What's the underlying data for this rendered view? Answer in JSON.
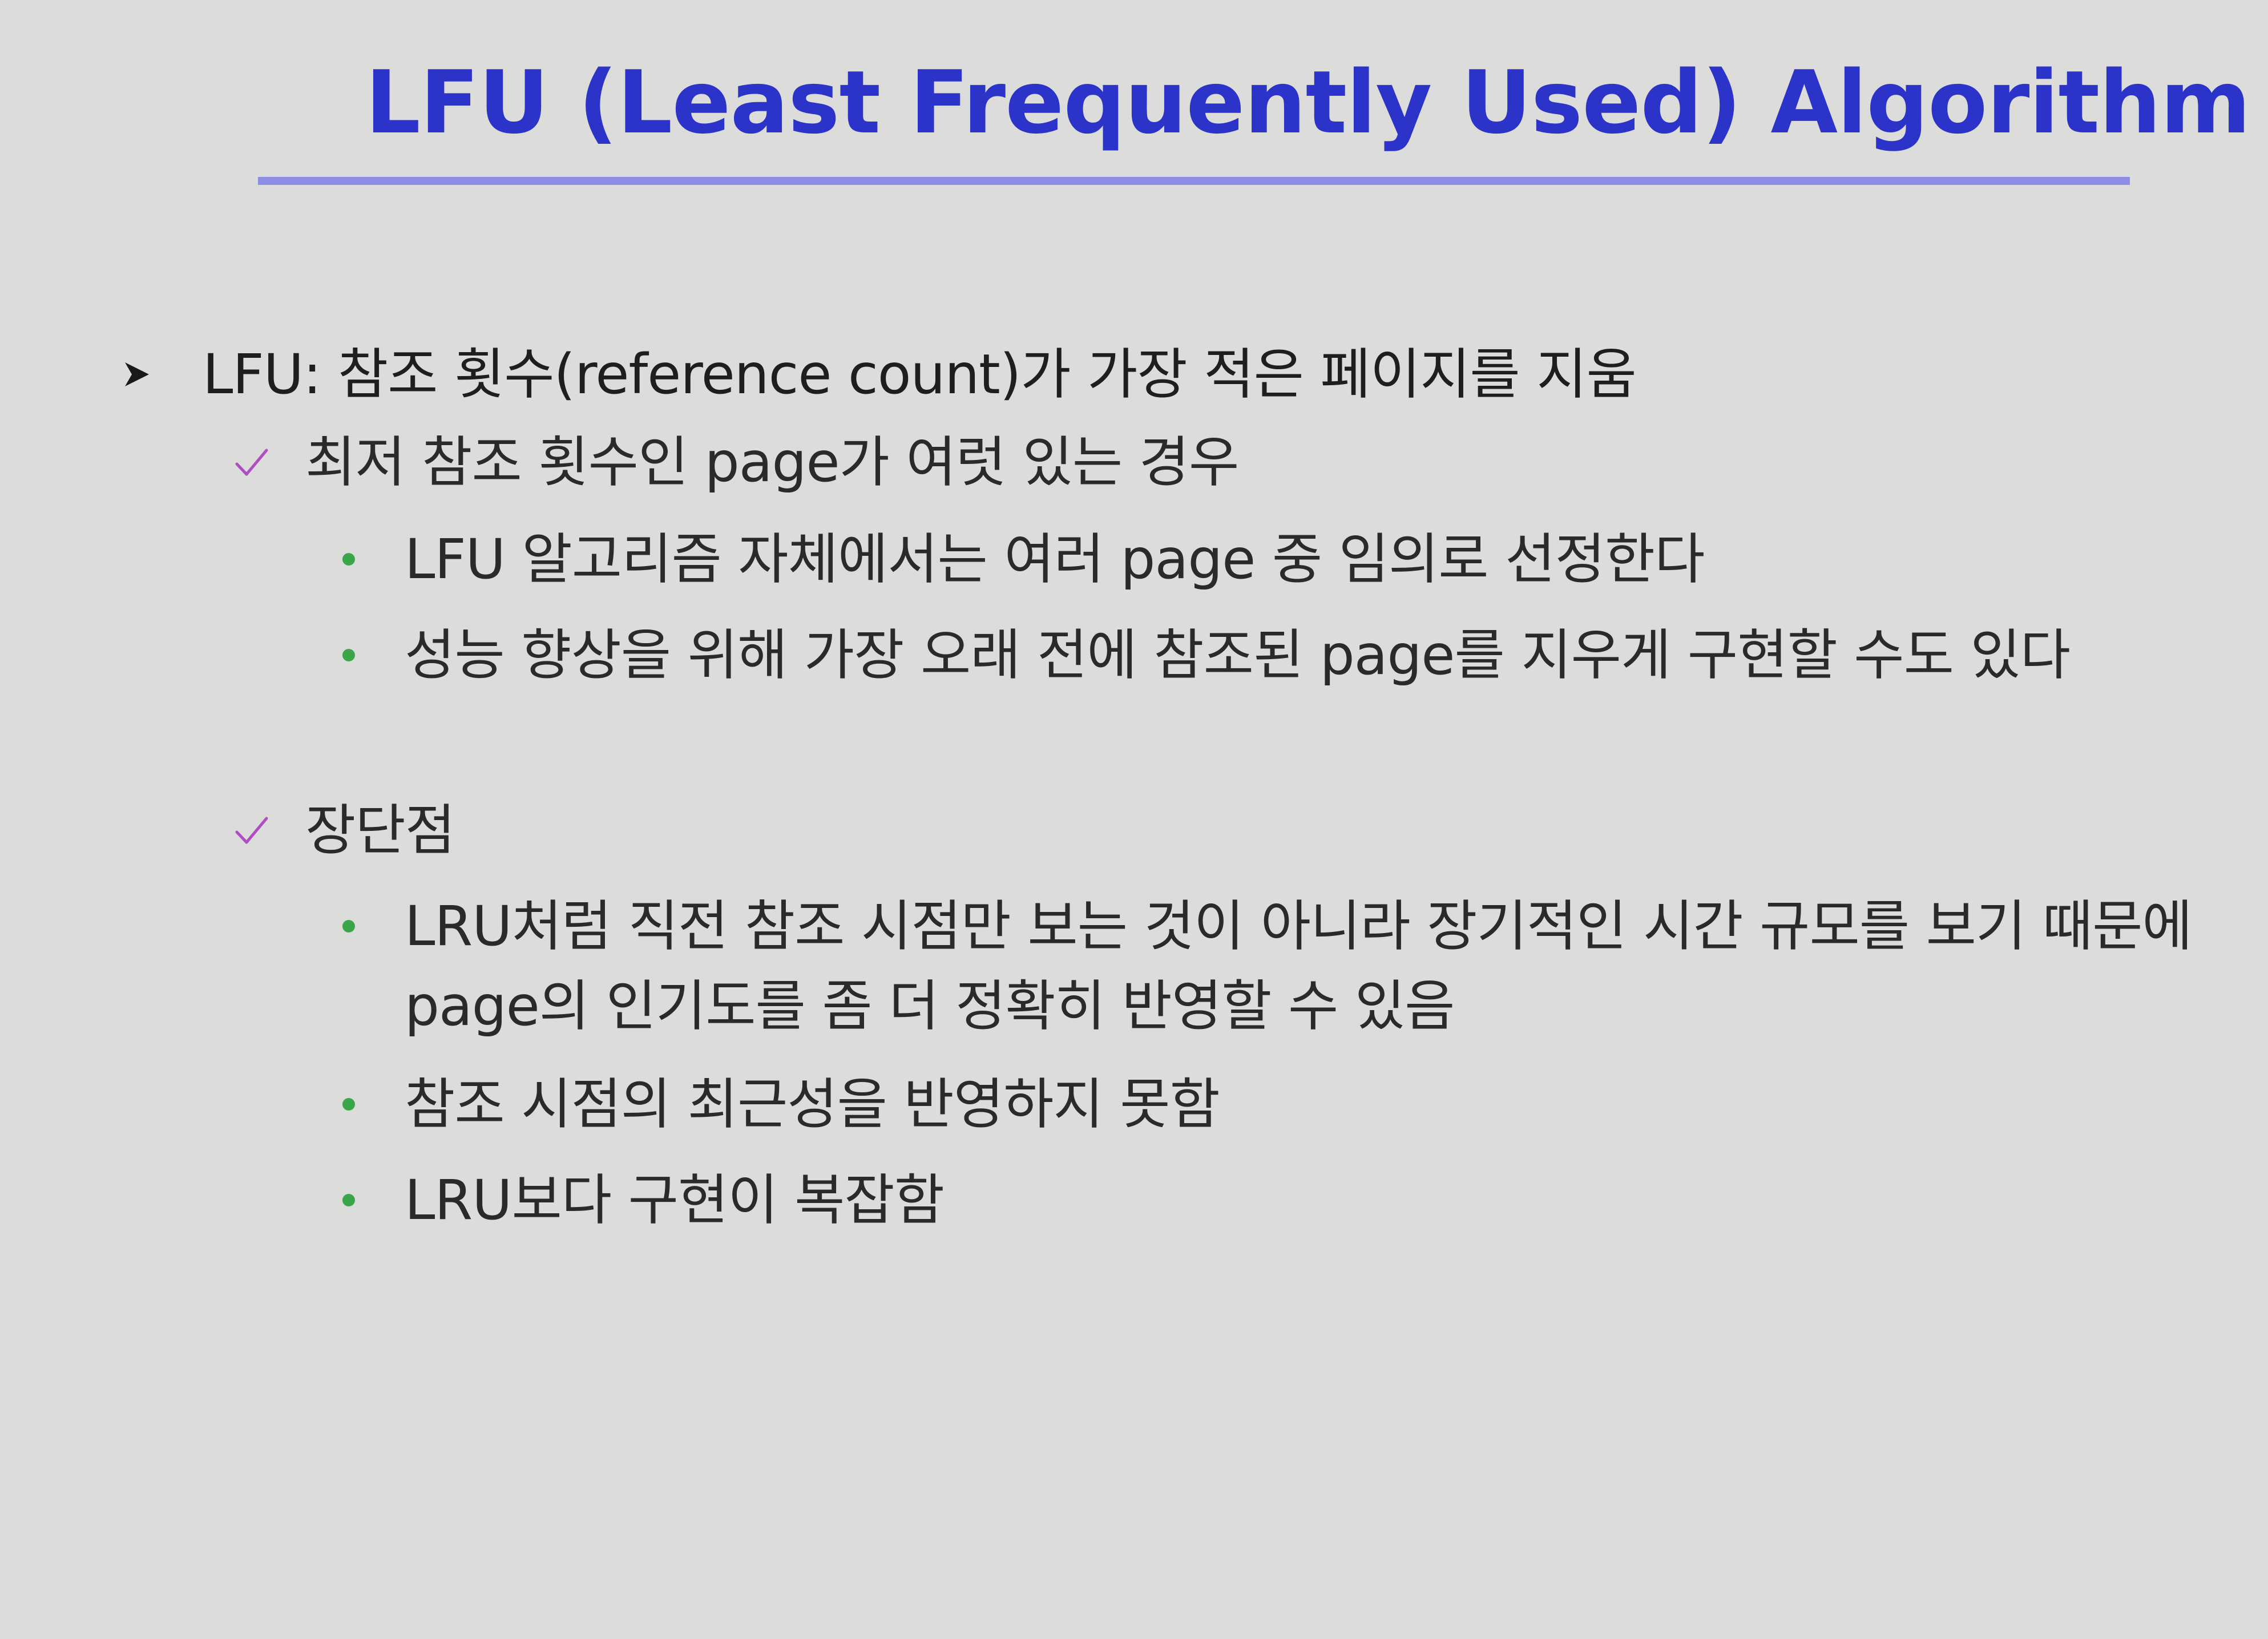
{
  "slide": {
    "title": "LFU (Least Frequently Used) Algorithm",
    "colors": {
      "title": "#2b33c9",
      "rule": "#8c8ee6",
      "background": "#dcdcdb",
      "check": "#b04cc4",
      "dot": "#3aa64a"
    },
    "bullets": [
      {
        "icon": "arrow-icon",
        "text": "LFU: 참조 횟수(reference count)가 가장 적은 페이지를 지움",
        "children": [
          {
            "icon": "check-icon",
            "text": "최저 참조 횟수인 page가 여럿 있는 경우",
            "children": [
              {
                "icon": "dot-icon",
                "text": "LFU 알고리즘 자체에서는 여러 page 중 임의로 선정한다"
              },
              {
                "icon": "dot-icon",
                "text": "성능 향상을 위해 가장 오래 전에 참조된 page를 지우게 구현할 수도 있다"
              }
            ]
          },
          {
            "icon": "check-icon",
            "text": "장단점",
            "children": [
              {
                "icon": "dot-icon",
                "text": "LRU처럼 직전 참조 시점만 보는 것이 아니라 장기적인 시간 규모를 보기 때문에 page의 인기도를 좀 더 정확히 반영할 수 있음"
              },
              {
                "icon": "dot-icon",
                "text": "참조 시점의 최근성을 반영하지 못함"
              },
              {
                "icon": "dot-icon",
                "text": "LRU보다 구현이 복잡함"
              }
            ]
          }
        ]
      }
    ]
  }
}
